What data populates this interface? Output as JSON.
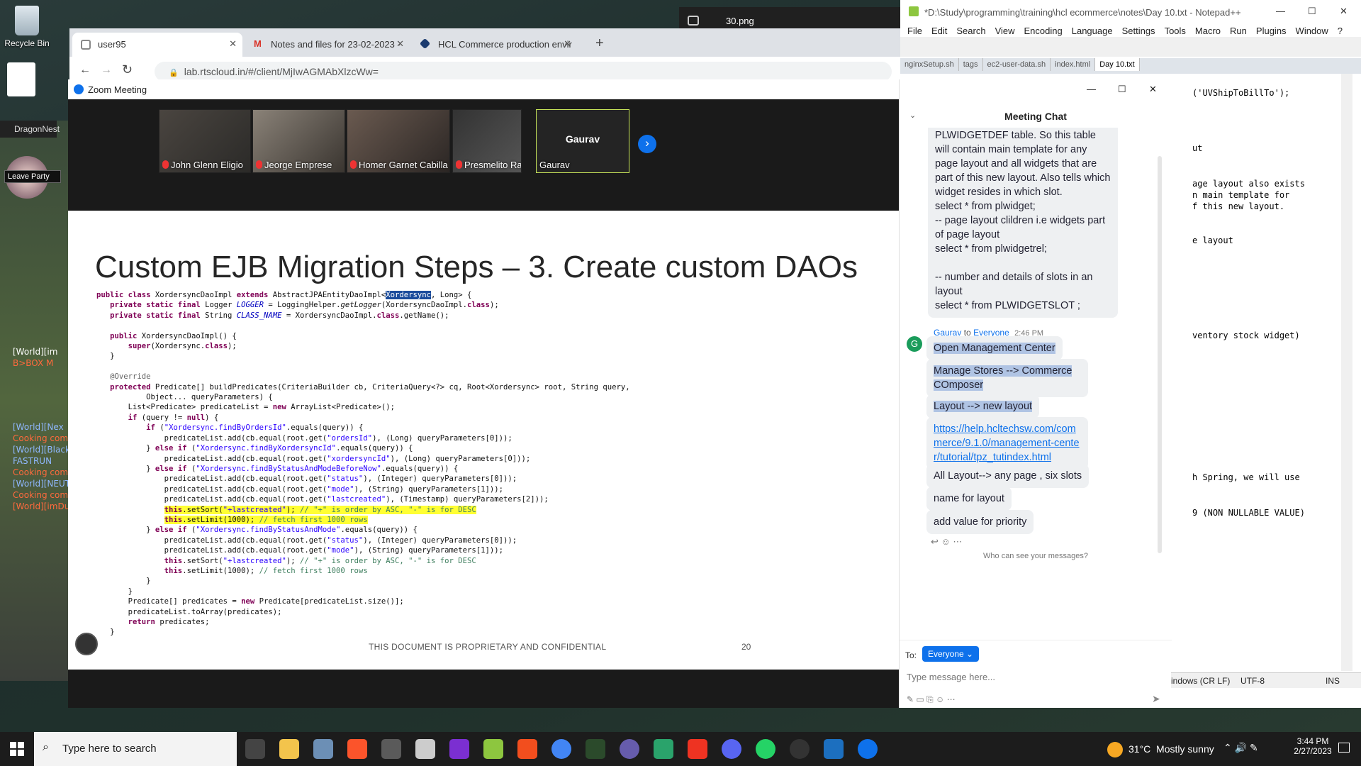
{
  "desktop": {
    "recycle_bin": "Recycle Bin",
    "dragonnest": "DragonNest",
    "leave_party": "Leave Party",
    "game_chat": [
      "[World][im",
      "B>BOX M",
      "[World][Nex",
      "Cooking com",
      "[World][Black",
      "FASTRUN",
      "Cooking com",
      "[World][NEUT",
      "Cooking com",
      "[World][imDu"
    ]
  },
  "chrome": {
    "tabs": [
      {
        "label": "user95"
      },
      {
        "label": "Notes and files for 23-02-2023 -"
      },
      {
        "label": "HCL Commerce production envir"
      }
    ],
    "url": "lab.rtscloud.in/#/client/MjIwAGMAbXlzcWw="
  },
  "photo_viewer": {
    "title": "30.png"
  },
  "zoom": {
    "title": "Zoom Meeting",
    "participants": [
      "John Glenn Eligio",
      "Jeorge Emprese",
      "Homer Garnet Cabilla",
      "Presmelito Rapatan V...",
      "Gaurav"
    ],
    "active_speaker_name": "Gaurav",
    "slide": {
      "title": "Custom EJB Migration Steps – 3. Create custom DAOs",
      "footer": "THIS DOCUMENT IS PROPRIETARY AND CONFIDENTIAL",
      "page_number": "20"
    }
  },
  "chat": {
    "header": "Meeting Chat",
    "earlier_message": "main page layout also exists in PLWIDGETDEF table. So this table will contain main template for any page layout and all widgets that are part of this new layout. Also tells which widget resides in which slot.\nselect * from plwidget;\n-- page layout clildren i.e widgets part of page layout\nselect * from plwidgetrel;\n\n-- number and details of slots in an layout\nselect * from PLWIDGETSLOT ;",
    "sender": "Gaurav",
    "to_label": "to",
    "recipient": "Everyone",
    "time": "2:46 PM",
    "avatar_letter": "G",
    "messages": [
      "Open Management Center",
      "Manage Stores --> Commerce COmposer",
      "Layout --> new layout",
      "https://help.hcltechsw.com/commerce/9.1.0/management-center/tutorial/tpz_tutindex.html",
      "All Layout--> any page , six slots",
      "name for layout",
      "add value for priority"
    ],
    "who_can_see": "Who can see your messages?",
    "to_prefix": "To:",
    "to_value": "Everyone",
    "input_placeholder": "Type message here..."
  },
  "notepad": {
    "title": "*D:\\Study\\programming\\training\\hcl ecommerce\\notes\\Day 10.txt - Notepad++",
    "menu": [
      "File",
      "Edit",
      "Search",
      "View",
      "Encoding",
      "Language",
      "Settings",
      "Tools",
      "Macro",
      "Run",
      "Plugins",
      "Window",
      "?"
    ],
    "tabs": [
      "nginxSetup.sh",
      "tags",
      "ec2-user-data.sh",
      "index.html",
      "Day 10.txt"
    ],
    "lines": [
      "('UVShipToBillTo');",
      "ut",
      "age layout also exists",
      "n main template for",
      "f this new layout.",
      "e layout",
      "ventory stock widget)",
      "h Spring, we will use",
      "9 (NON NULLABLE VALUE)"
    ],
    "status_eol": "indows (CR LF)",
    "status_enc": "UTF-8",
    "status_ins": "INS"
  },
  "taskbar": {
    "search_placeholder": "Type here to search",
    "weather": "31°C  Mostly sunny",
    "time": "3:44 PM",
    "date": "2/27/2023"
  }
}
